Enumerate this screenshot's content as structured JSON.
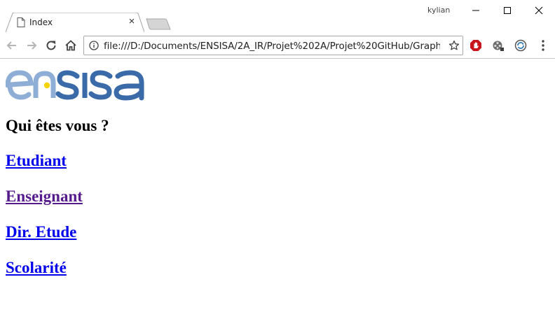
{
  "browser": {
    "tab": {
      "title": "Index",
      "close_glyph": "×"
    },
    "profile_name": "kylian",
    "address_bar": {
      "url": "file:///D:/Documents/ENSISA/2A_IR/Projet%202A/Projet%20GitHub/GraphVi..."
    },
    "icons": {
      "tab": "document-icon",
      "info": "info-icon",
      "star": "star-icon",
      "back": "back-arrow-icon",
      "forward": "forward-arrow-icon",
      "reload": "reload-icon",
      "home": "home-icon",
      "extensions": [
        "stop-extension-icon",
        "film-extension-icon",
        "sync-extension-icon"
      ],
      "menu": "menu-dots-icon"
    }
  },
  "page": {
    "logo": {
      "text": "ensisa",
      "colors": {
        "light": "#8eaed6",
        "dark": "#3a6aa8",
        "dot": "#f4d400"
      }
    },
    "heading": "Qui êtes vous ?",
    "links": [
      {
        "label": "Etudiant",
        "visited": false
      },
      {
        "label": "Enseignant",
        "visited": true
      },
      {
        "label": "Dir. Etude",
        "visited": false
      },
      {
        "label": "Scolarité",
        "visited": false
      }
    ],
    "colors": {
      "link": "#0000ee",
      "visited": "#551a8b"
    }
  }
}
